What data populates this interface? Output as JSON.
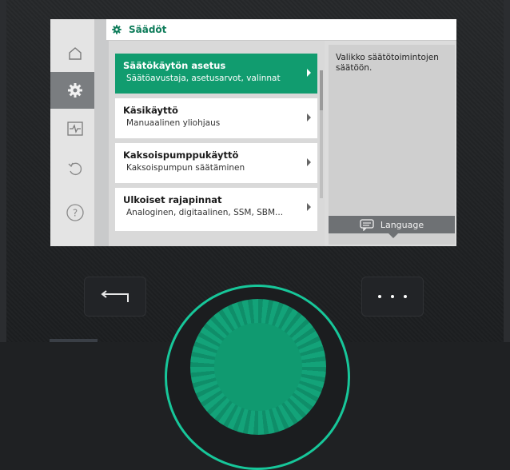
{
  "header": {
    "title": "Säädöt",
    "icon": "gear-icon"
  },
  "rail": {
    "items": [
      {
        "name": "home",
        "icon": "home-icon",
        "active": false
      },
      {
        "name": "settings",
        "icon": "gear-icon",
        "active": true
      },
      {
        "name": "diagnostics",
        "icon": "pulse-icon",
        "active": false
      },
      {
        "name": "restore",
        "icon": "undo-icon",
        "active": false
      },
      {
        "name": "help",
        "icon": "help-icon",
        "active": false
      }
    ]
  },
  "menu": {
    "items": [
      {
        "title": "Säätökäytön asetus",
        "subtitle": "Säätöavustaja, asetusarvot, valinnat",
        "selected": true
      },
      {
        "title": "Käsikäyttö",
        "subtitle": "Manuaalinen yliohjaus",
        "selected": false
      },
      {
        "title": "Kaksoispumppukäyttö",
        "subtitle": "Kaksoispumpun säätäminen",
        "selected": false
      },
      {
        "title": "Ulkoiset rajapinnat",
        "subtitle": "Analoginen, digitaalinen, SSM, SBM...",
        "selected": false
      }
    ]
  },
  "info": {
    "text": "Valikko säätötoimintojen säätöön.",
    "language_label": "Language"
  },
  "hardware": {
    "back_icon": "back-arrow-icon",
    "context_icon": "more-dots-icon"
  },
  "colors": {
    "accent": "#119c6f",
    "knob_ring": "#17c79a",
    "rail_active": "#7a7d80"
  }
}
